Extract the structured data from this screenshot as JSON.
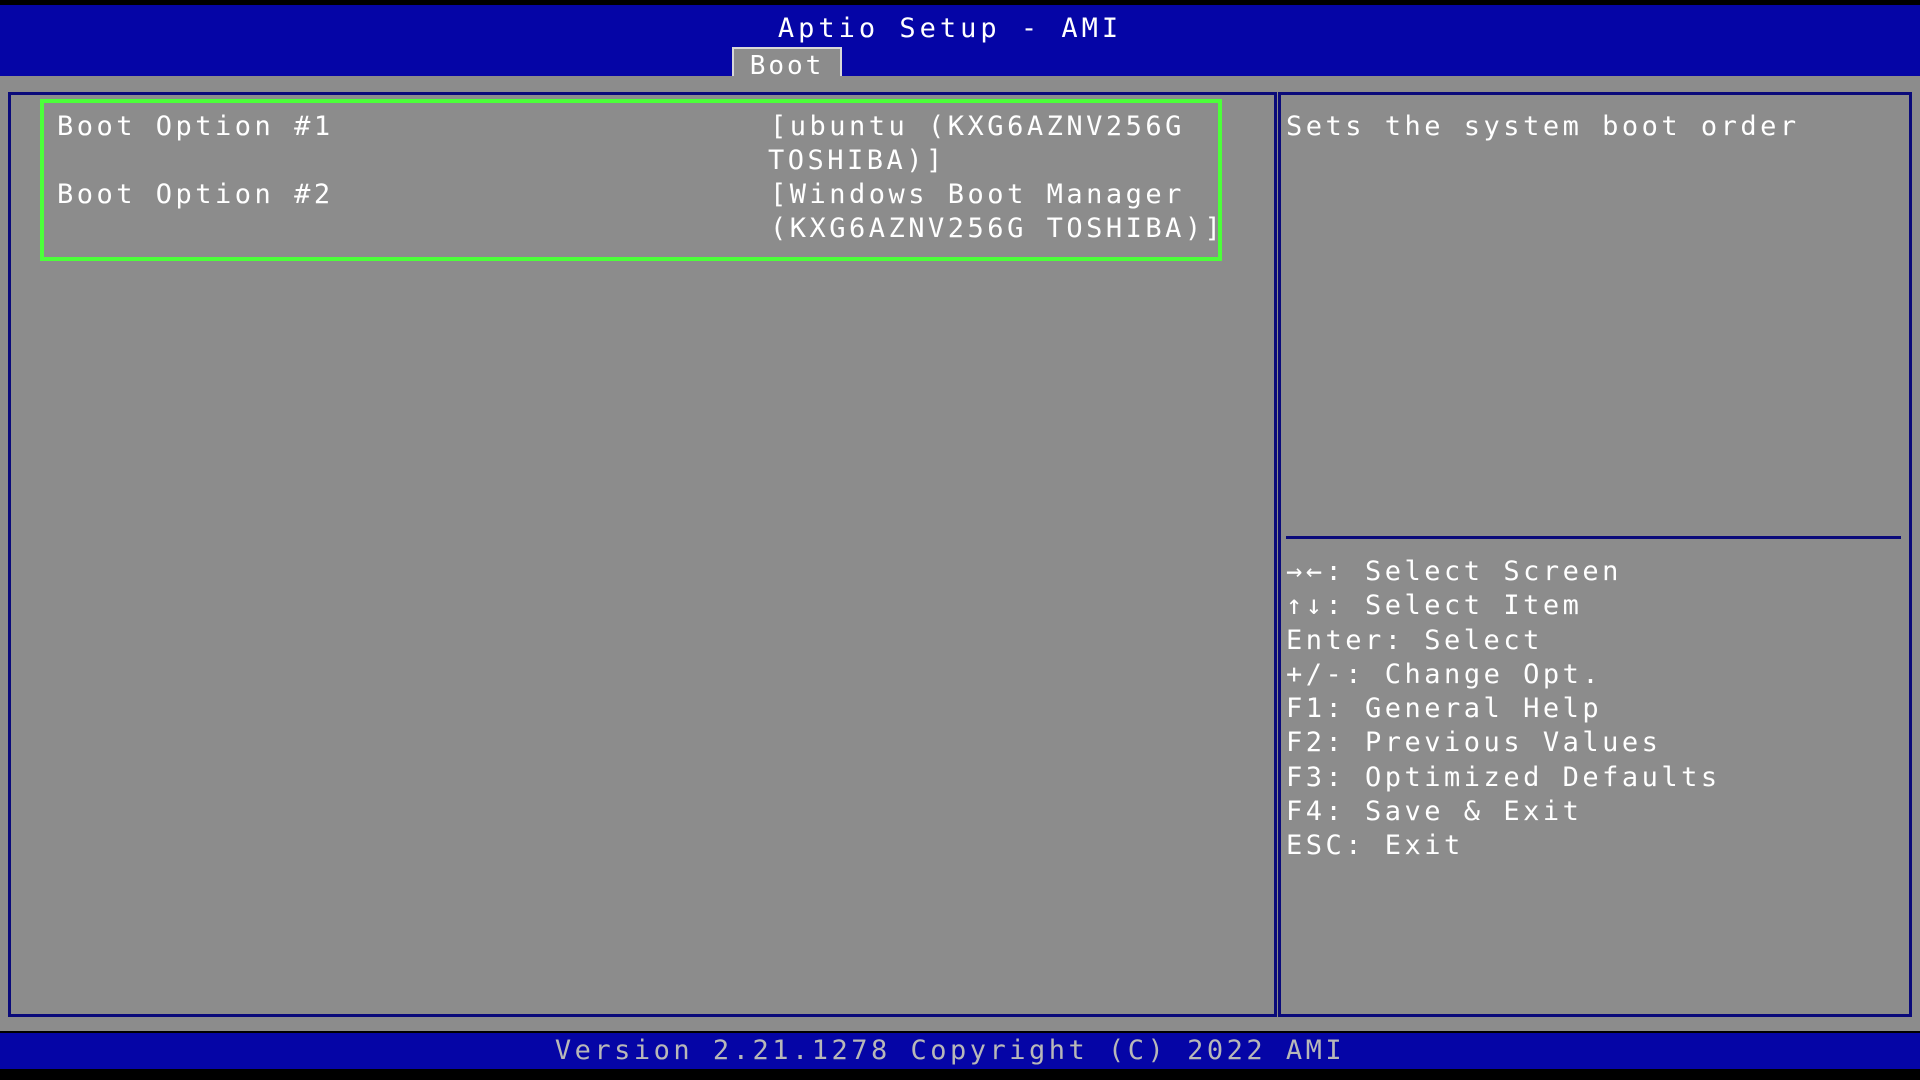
{
  "header": {
    "title": "Aptio Setup - AMI",
    "tabs": [
      {
        "label": "Boot",
        "active": true
      }
    ]
  },
  "boot_options": [
    {
      "label": "Boot Option #1",
      "value_lines": [
        "[ubuntu (KXG6AZNV256G",
        "TOSHIBA)]"
      ]
    },
    {
      "label": "Boot Option #2",
      "value_lines": [
        "[Windows Boot Manager",
        "(KXG6AZNV256G TOSHIBA)]"
      ]
    }
  ],
  "help": {
    "text": "Sets the system boot order"
  },
  "keys": [
    {
      "key": "→←",
      "desc": ": Select Screen"
    },
    {
      "key": "↑↓",
      "desc": ": Select Item"
    },
    {
      "key": "Enter",
      "desc": ": Select"
    },
    {
      "key": "+/-",
      "desc": ": Change Opt."
    },
    {
      "key": "F1",
      "desc": ": General Help"
    },
    {
      "key": "F2",
      "desc": ": Previous Values"
    },
    {
      "key": "F3",
      "desc": ": Optimized Defaults"
    },
    {
      "key": "F4",
      "desc": ": Save & Exit"
    },
    {
      "key": "ESC",
      "desc": ": Exit"
    }
  ],
  "footer": {
    "version": "Version 2.21.1278 Copyright (C) 2022 AMI"
  },
  "colors": {
    "header_bg": "#0505a6",
    "panel_bg": "#8c8c8c",
    "selection_border": "#4cff3a",
    "panel_border": "#0a0a7a",
    "text": "#ffffff"
  }
}
